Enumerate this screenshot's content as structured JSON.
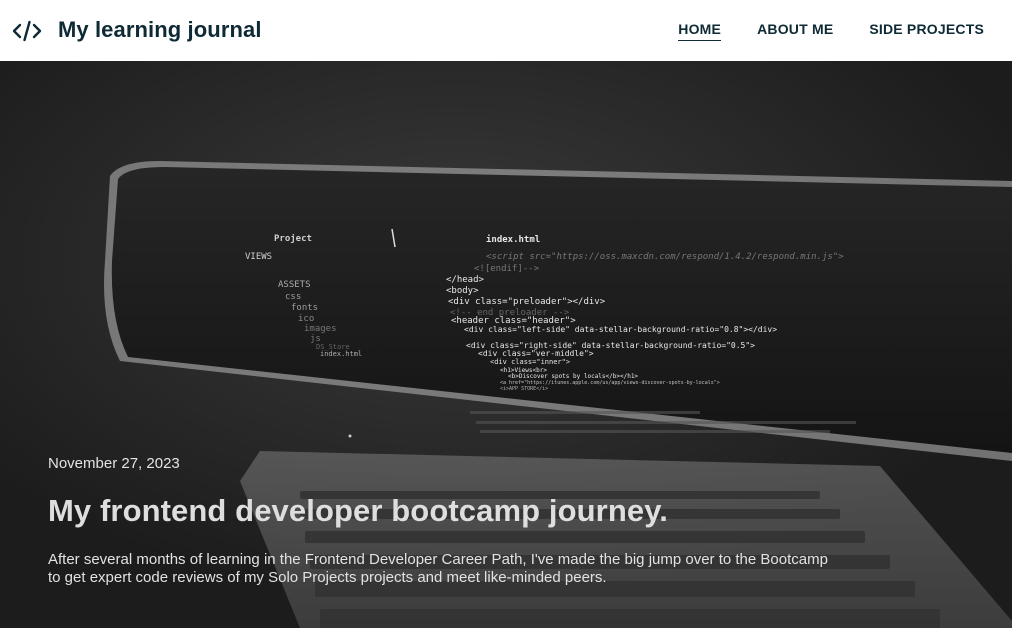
{
  "header": {
    "brand_icon": "code-brackets-icon",
    "brand_title": "My learning journal",
    "nav": [
      {
        "label": "HOME",
        "active": true
      },
      {
        "label": "ABOUT ME",
        "active": false
      },
      {
        "label": "SIDE PROJECTS",
        "active": false
      }
    ]
  },
  "hero": {
    "date": "November 27, 2023",
    "title": "My frontend developer bootcamp journey.",
    "excerpt": "After several months of learning in the Frontend Developer Career Path, I've made the big jump over to the Bootcamp to get expert code reviews of my Solo Projects projects and meet like-minded peers."
  },
  "colors": {
    "header_bg": "#ffffff",
    "brand_text": "#0e2a35",
    "hero_text": "#e2e2e2"
  }
}
